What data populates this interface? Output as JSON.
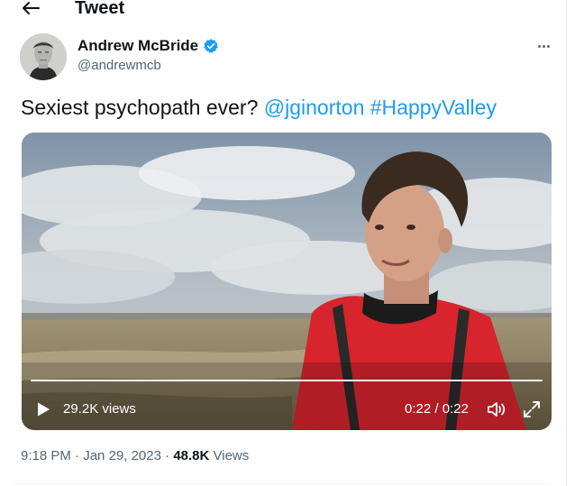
{
  "header": {
    "title": "Tweet",
    "back_icon": "arrow-left-icon"
  },
  "author": {
    "display_name": "Andrew McBride",
    "handle": "@andrewmcb",
    "verified": true,
    "verified_color": "#1d9bf0"
  },
  "tweet": {
    "text": "Sexiest psychopath ever?",
    "mention": "@jginorton",
    "hashtag": "#HappyValley",
    "link_color": "#1d9bf0"
  },
  "video": {
    "views": "29.2K views",
    "time": "0:22 / 0:22",
    "progress": 1.0
  },
  "meta": {
    "time": "9:18 PM",
    "date": "Jan 29, 2023",
    "separator": "·",
    "views_count": "48.8K",
    "views_label": "Views"
  },
  "colors": {
    "text": "#0f1419",
    "secondary": "#536471",
    "accent": "#1d9bf0"
  }
}
